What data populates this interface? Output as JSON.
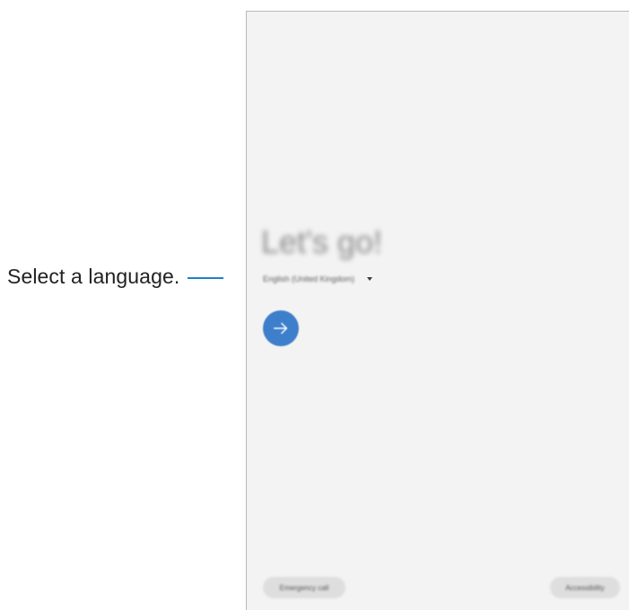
{
  "callout": {
    "text": "Select a language."
  },
  "screen": {
    "welcome_title": "Let's go!",
    "language": {
      "value": "English (United Kingdom)"
    },
    "buttons": {
      "emergency_call": "Emergency call",
      "accessibility": "Accessibility"
    }
  },
  "colors": {
    "accent": "#3d7fcb",
    "callout_line": "#1d82c6",
    "screen_background": "#f3f3f3"
  },
  "icons": {
    "next": "arrow-right-icon",
    "dropdown": "caret-down-icon"
  }
}
